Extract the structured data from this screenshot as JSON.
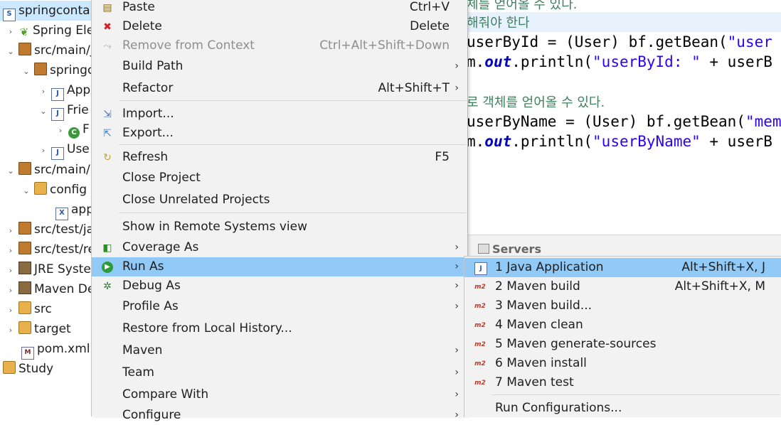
{
  "explorer": {
    "rows": [
      {
        "label": "springcontai",
        "twisty": "",
        "icon": "project"
      },
      {
        "label": "Spring Ele",
        "twisty": "›",
        "icon": "leaf"
      },
      {
        "label": "src/main/j",
        "twisty": "⌄",
        "icon": "folder"
      },
      {
        "label": "springc",
        "twisty": "⌄",
        "icon": "package"
      },
      {
        "label": "App",
        "twisty": "›",
        "icon": "java"
      },
      {
        "label": "Frie",
        "twisty": "⌄",
        "icon": "java"
      },
      {
        "label": "F",
        "twisty": "›",
        "icon": "class"
      },
      {
        "label": "Use",
        "twisty": "›",
        "icon": "java"
      },
      {
        "label": "src/main/",
        "twisty": "⌄",
        "icon": "folder"
      },
      {
        "label": "config",
        "twisty": "⌄",
        "icon": "folder"
      },
      {
        "label": "app",
        "twisty": "",
        "icon": "xml"
      },
      {
        "label": "src/test/ja",
        "twisty": "›",
        "icon": "folder"
      },
      {
        "label": "src/test/re",
        "twisty": "›",
        "icon": "folder"
      },
      {
        "label": "JRE Syster",
        "twisty": "›",
        "icon": "lib"
      },
      {
        "label": "Maven De",
        "twisty": "›",
        "icon": "lib"
      },
      {
        "label": "src",
        "twisty": "›",
        "icon": "folder"
      },
      {
        "label": "target",
        "twisty": "›",
        "icon": "folder"
      },
      {
        "label": "pom.xml",
        "twisty": "",
        "icon": "m"
      },
      {
        "label": "Study",
        "twisty": "",
        "icon": "project"
      }
    ]
  },
  "editor": {
    "line1_comment": "체를 얻어올 수 있다.",
    "line2_comment": "해줘야 한다",
    "line3": {
      "a": "userById = (User) bf.getBean(",
      "s": "\"user"
    },
    "line4": {
      "a": "m.",
      "f": "out",
      "b": ".println(",
      "s": "\"userById: \"",
      "c": " + userB"
    },
    "line5_comment": "로 객체를 얻어올 수 있다.",
    "line6": {
      "a": "userByName = (User) bf.getBean(",
      "s": "\"mem"
    },
    "line7": {
      "a": "m.",
      "f": "out",
      "b": ".println(",
      "s": "\"userByName\"",
      "c": " + userB"
    }
  },
  "servers_tab": "Servers",
  "context_menu": {
    "items": [
      {
        "label": "Paste",
        "shortcut": "Ctrl+V",
        "icon": "paste-icon"
      },
      {
        "label": "Delete",
        "shortcut": "Delete",
        "icon": "delete-icon"
      },
      {
        "label": "Remove from Context",
        "shortcut": "Ctrl+Alt+Shift+Down",
        "icon": "remove-context-icon"
      },
      {
        "label": "Build Path",
        "shortcut": "",
        "icon": ""
      },
      {
        "label": "Refactor",
        "shortcut": "Alt+Shift+T",
        "icon": ""
      },
      {
        "label": "Import...",
        "shortcut": "",
        "icon": "import-icon"
      },
      {
        "label": "Export...",
        "shortcut": "",
        "icon": "export-icon"
      },
      {
        "label": "Refresh",
        "shortcut": "F5",
        "icon": "refresh-icon"
      },
      {
        "label": "Close Project",
        "shortcut": "",
        "icon": ""
      },
      {
        "label": "Close Unrelated Projects",
        "shortcut": "",
        "icon": ""
      },
      {
        "label": "Show in Remote Systems view",
        "shortcut": "",
        "icon": ""
      },
      {
        "label": "Coverage As",
        "shortcut": "",
        "icon": "coverage-icon"
      },
      {
        "label": "Run As",
        "shortcut": "",
        "icon": "run-icon"
      },
      {
        "label": "Debug As",
        "shortcut": "",
        "icon": "debug-icon"
      },
      {
        "label": "Profile As",
        "shortcut": "",
        "icon": ""
      },
      {
        "label": "Restore from Local History...",
        "shortcut": "",
        "icon": ""
      },
      {
        "label": "Maven",
        "shortcut": "",
        "icon": ""
      },
      {
        "label": "Team",
        "shortcut": "",
        "icon": ""
      },
      {
        "label": "Compare With",
        "shortcut": "",
        "icon": ""
      },
      {
        "label": "Configure",
        "shortcut": "",
        "icon": ""
      }
    ]
  },
  "run_as_submenu": {
    "items": [
      {
        "label": "1 Java Application",
        "shortcut": "Alt+Shift+X, J",
        "icon": "java-app-icon"
      },
      {
        "label": "2 Maven build",
        "shortcut": "Alt+Shift+X, M",
        "icon": "m2-icon"
      },
      {
        "label": "3 Maven build...",
        "shortcut": "",
        "icon": "m2-icon"
      },
      {
        "label": "4 Maven clean",
        "shortcut": "",
        "icon": "m2-icon"
      },
      {
        "label": "5 Maven generate-sources",
        "shortcut": "",
        "icon": "m2-icon"
      },
      {
        "label": "6 Maven install",
        "shortcut": "",
        "icon": "m2-icon"
      },
      {
        "label": "7 Maven test",
        "shortcut": "",
        "icon": "m2-icon"
      },
      {
        "label": "Run Configurations...",
        "shortcut": "",
        "icon": ""
      }
    ],
    "m2_text": "m2",
    "java_icon_text": "J"
  }
}
